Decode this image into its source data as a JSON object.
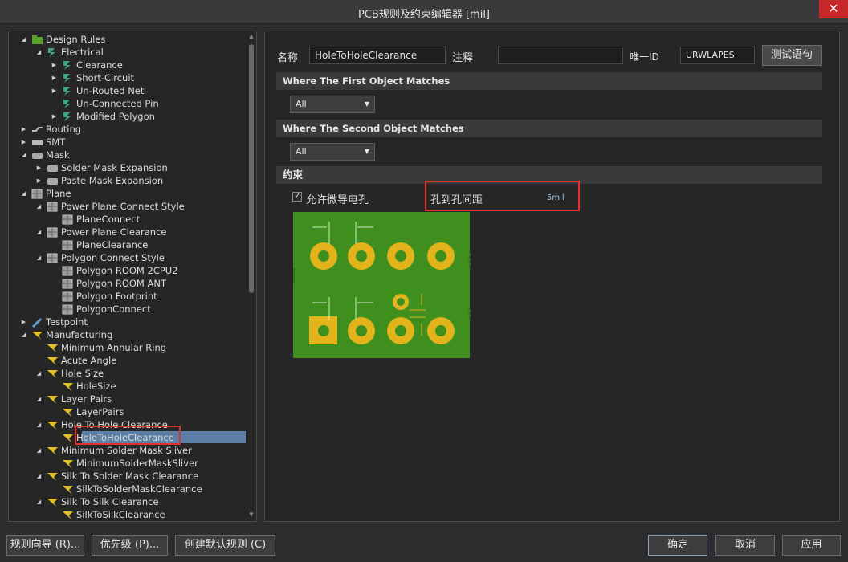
{
  "window": {
    "title": "PCB规则及约束编辑器 [mil]",
    "close": "✕"
  },
  "tree": {
    "items": [
      {
        "label": "Design Rules"
      },
      {
        "label": "Electrical"
      },
      {
        "label": "Clearance"
      },
      {
        "label": "Short-Circuit"
      },
      {
        "label": "Un-Routed Net"
      },
      {
        "label": "Un-Connected Pin"
      },
      {
        "label": "Modified Polygon"
      },
      {
        "label": "Routing"
      },
      {
        "label": "SMT"
      },
      {
        "label": "Mask"
      },
      {
        "label": "Solder Mask Expansion"
      },
      {
        "label": "Paste Mask Expansion"
      },
      {
        "label": "Plane"
      },
      {
        "label": "Power Plane Connect Style"
      },
      {
        "label": "PlaneConnect"
      },
      {
        "label": "Power Plane Clearance"
      },
      {
        "label": "PlaneClearance"
      },
      {
        "label": "Polygon Connect Style"
      },
      {
        "label": "Polygon ROOM 2CPU2"
      },
      {
        "label": "Polygon ROOM ANT"
      },
      {
        "label": "Polygon Footprint"
      },
      {
        "label": "PolygonConnect"
      },
      {
        "label": "Testpoint"
      },
      {
        "label": "Manufacturing"
      },
      {
        "label": "Minimum Annular Ring"
      },
      {
        "label": "Acute Angle"
      },
      {
        "label": "Hole Size"
      },
      {
        "label": "HoleSize"
      },
      {
        "label": "Layer Pairs"
      },
      {
        "label": "LayerPairs"
      },
      {
        "label": "Hole To Hole Clearance"
      },
      {
        "label": "HoleToHoleClearance"
      },
      {
        "label": "Minimum Solder Mask Sliver"
      },
      {
        "label": "MinimumSolderMaskSliver"
      },
      {
        "label": "Silk To Solder Mask Clearance"
      },
      {
        "label": "SilkToSolderMaskClearance"
      },
      {
        "label": "Silk To Silk Clearance"
      },
      {
        "label": "SilkToSilkClearance"
      }
    ]
  },
  "rule": {
    "name_label": "名称",
    "name_value": "HoleToHoleClearance",
    "comment_label": "注释",
    "comment_value": "",
    "uid_label": "唯一ID",
    "uid_value": "URWLAPES",
    "test_button": "测试语句"
  },
  "first_match": {
    "header": "Where The First Object Matches",
    "value": "All"
  },
  "second_match": {
    "header": "Where The Second Object Matches",
    "value": "All"
  },
  "constraints": {
    "header": "约束",
    "allow_micro_via_label": "允许微导电孔",
    "allow_micro_via_checked": true,
    "clearance_label": "孔到孔间距",
    "clearance_value": "5mil"
  },
  "buttons": {
    "rule_wizard": "规则向导 (R)...",
    "priority": "优先级 (P)...",
    "create_default": "创建默认规则 (C)",
    "ok": "确定",
    "cancel": "取消",
    "apply": "应用"
  },
  "colors": {
    "board": "#3f8f1f",
    "pad": "#e2b31a",
    "hole": "#3f8f1f",
    "selection": "#5b7fa6",
    "highlight_box": "#e03030"
  }
}
